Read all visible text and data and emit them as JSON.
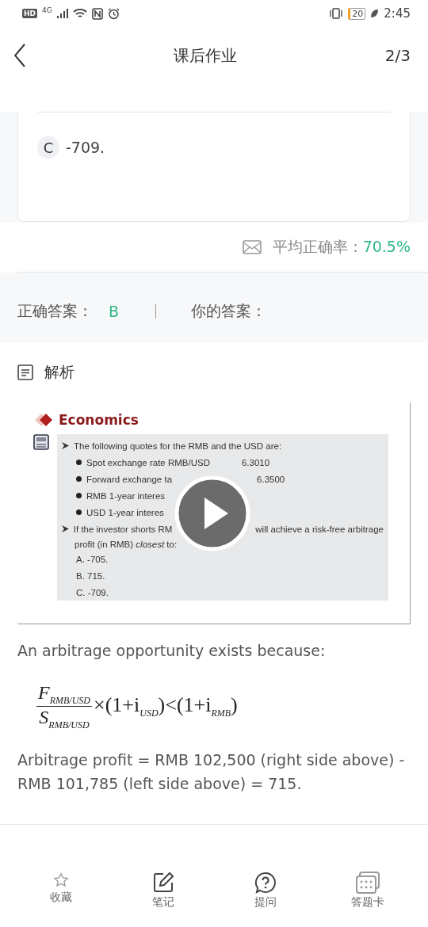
{
  "status_bar": {
    "badges": [
      "HD",
      "4G"
    ],
    "battery": "20",
    "time": "2:45"
  },
  "header": {
    "title": "课后作业",
    "page": "2/3"
  },
  "options": [
    {
      "letter": "C",
      "text": "-709."
    }
  ],
  "accuracy": {
    "label": "平均正确率：",
    "value": "70.5%"
  },
  "answers": {
    "correct_label": "正确答案：",
    "correct": "B",
    "yours_label": "你的答案："
  },
  "analysis": {
    "title": "解析"
  },
  "slide": {
    "brand": "Economics",
    "lines": [
      {
        "kind": "arrow",
        "parts": [
          "The following quotes for the RMB and the USD are:"
        ]
      },
      {
        "kind": "bullet",
        "parts": [
          "Spot exchange rate RMB/USD",
          "6.3010"
        ]
      },
      {
        "kind": "bullet",
        "parts": [
          "Forward exchange ta",
          "6.3500"
        ]
      },
      {
        "kind": "bullet",
        "parts": [
          "RMB 1-year interes"
        ]
      },
      {
        "kind": "bullet",
        "parts": [
          "USD 1-year interes"
        ]
      },
      {
        "kind": "arrow",
        "parts": [
          "If the investor shorts RM",
          "will achieve a risk-free arbitrage"
        ]
      },
      {
        "kind": "cont",
        "parts": [
          "profit (in RMB) *closest* to:"
        ]
      },
      {
        "kind": "choice",
        "parts": [
          "A.  -705."
        ]
      },
      {
        "kind": "choice",
        "parts": [
          "B.  715."
        ]
      },
      {
        "kind": "choice",
        "parts": [
          "C.  -709."
        ]
      }
    ]
  },
  "explanation": {
    "intro": "An arbitrage opportunity exists because:",
    "formula": {
      "numerator": "F$_{RMB/USD}$",
      "denominator": "S$_{RMB/USD}$",
      "rest": "×(1+i$_{USD}$)<(1+i$_{RMB}$)"
    },
    "profit": "Arbitrage profit = RMB 102,500 (right side above) - RMB 101,785 (left side above) = 715."
  },
  "nav": [
    {
      "kind": "star",
      "label": "收藏"
    },
    {
      "kind": "note",
      "label": "笔记"
    },
    {
      "kind": "question",
      "label": "提问"
    },
    {
      "kind": "card",
      "label": "答题卡"
    }
  ]
}
